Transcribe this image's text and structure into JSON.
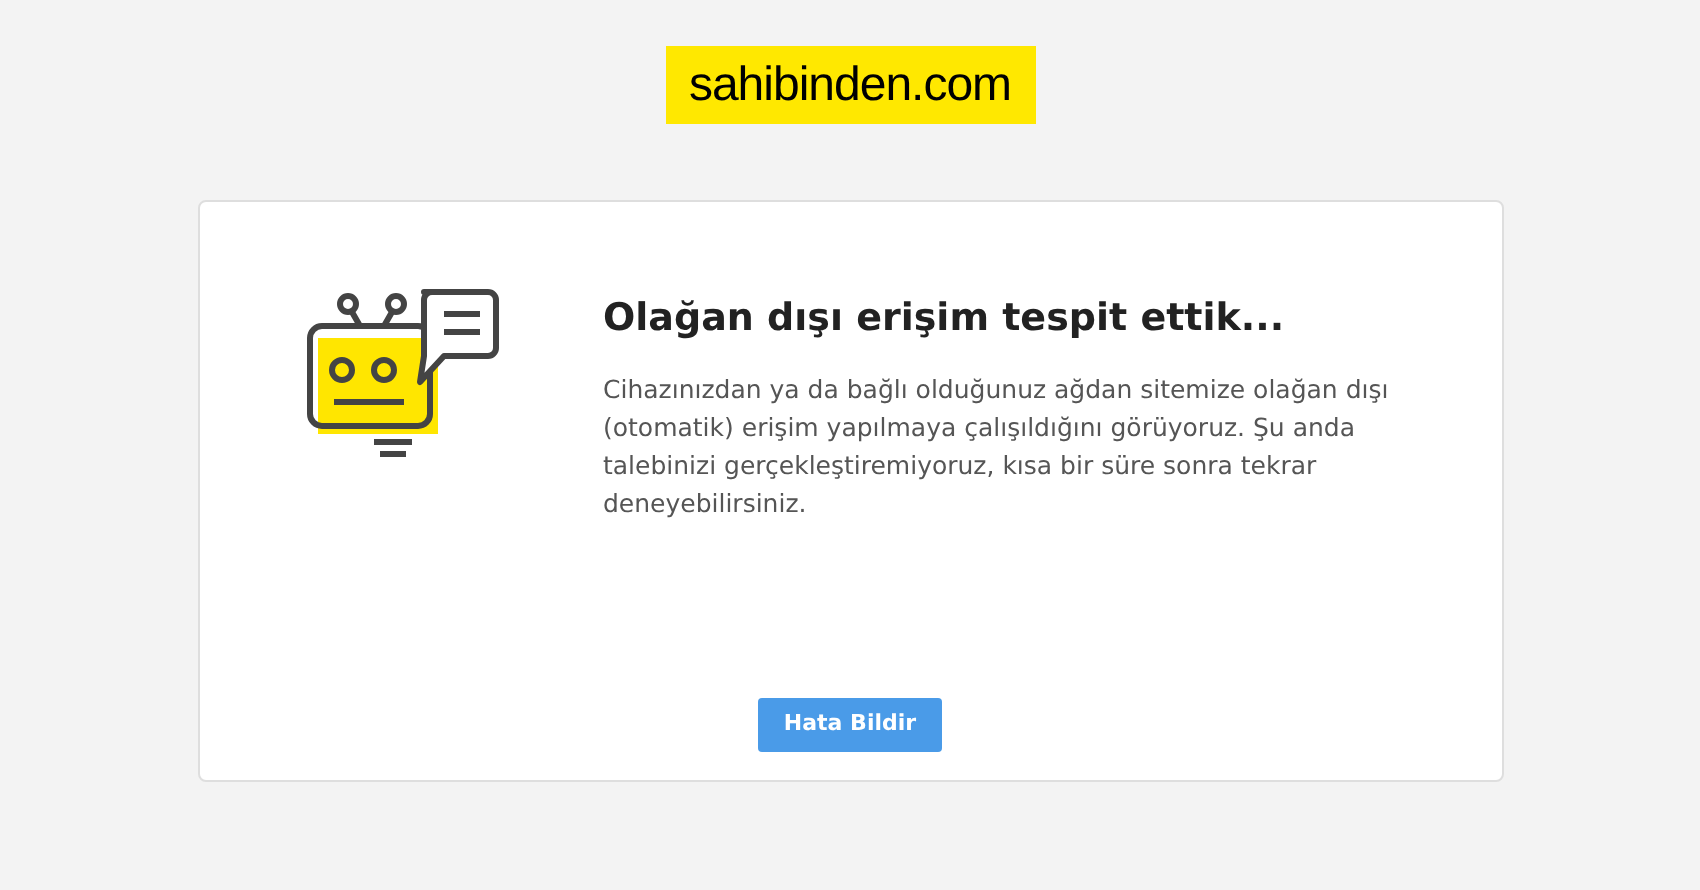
{
  "logo": {
    "text": "sahibinden.com"
  },
  "message": {
    "title": "Olağan dışı erişim tespit ettik...",
    "body": "Cihazınızdan ya da bağlı olduğunuz ağdan sitemize olağan dışı (otomatik) erişim yapılmaya çalışıldığını görüyoruz. Şu anda talebinizi gerçekleştiremiyoruz, kısa bir süre sonra tekrar deneyebilirsiniz."
  },
  "button": {
    "label": "Hata Bildir"
  }
}
